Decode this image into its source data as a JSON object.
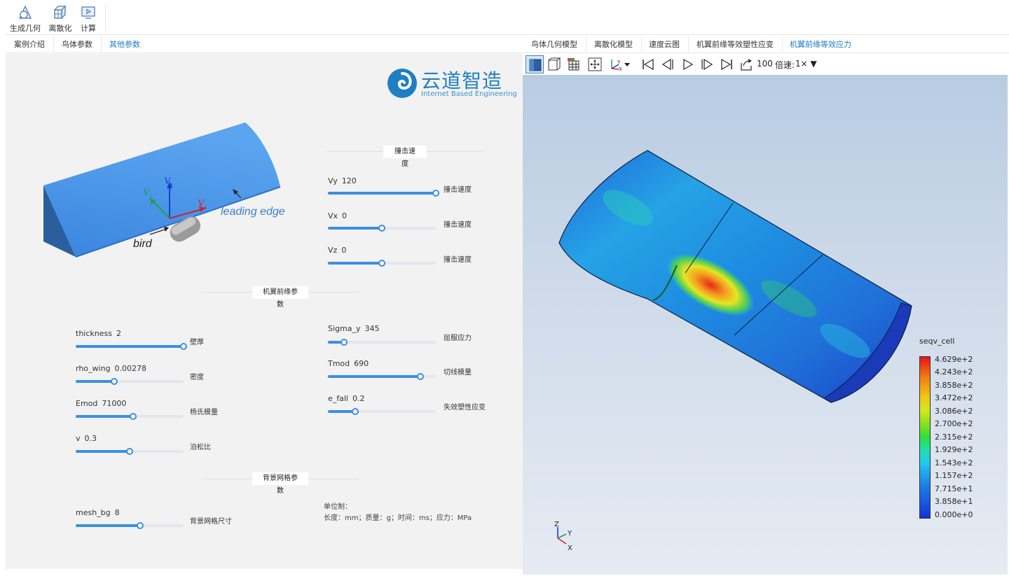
{
  "toolbar": {
    "items": [
      {
        "label": "生成几何",
        "icon": "geometry-icon"
      },
      {
        "label": "离散化",
        "icon": "mesh-cube-icon"
      },
      {
        "label": "计算",
        "icon": "compute-monitor-icon"
      }
    ]
  },
  "left_tabs": [
    {
      "label": "案例介绍",
      "active": false
    },
    {
      "label": "鸟体参数",
      "active": false
    },
    {
      "label": "其他参数",
      "active": true
    }
  ],
  "right_tabs": [
    {
      "label": "鸟体几何模型",
      "active": false
    },
    {
      "label": "离散化模型",
      "active": false
    },
    {
      "label": "速度云图",
      "active": false
    },
    {
      "label": "机翼前缘等效塑性应变",
      "active": false
    },
    {
      "label": "机翼前缘等效应力",
      "active": true
    }
  ],
  "logo": {
    "title": "云道智造",
    "subtitle": "Internet Based Engineering"
  },
  "diagram": {
    "vz": "V",
    "vz_sub": "z",
    "vy": "V",
    "vy_sub": "y",
    "vx": "V",
    "vx_sub": "x",
    "leading_edge": "leading edge",
    "bird": "bird"
  },
  "sections": {
    "impact_velocity": "撞击速度",
    "wing_params": "机翼前缘参数",
    "bg_mesh": "背景网格参数"
  },
  "params": {
    "vy": {
      "name": "Vy",
      "value": "120",
      "fraction": 1.0,
      "desc": "撞击速度"
    },
    "vx": {
      "name": "Vx",
      "value": "0",
      "fraction": 0.5,
      "desc": "撞击速度"
    },
    "vz": {
      "name": "Vz",
      "value": "0",
      "fraction": 0.5,
      "desc": "撞击速度"
    },
    "thickness": {
      "name": "thickness",
      "value": "2",
      "fraction": 1.0,
      "desc": "壁厚"
    },
    "rho_wing": {
      "name": "rho_wing",
      "value": "0.00278",
      "fraction": 0.36,
      "desc": "密度"
    },
    "emod": {
      "name": "Emod",
      "value": "71000",
      "fraction": 0.53,
      "desc": "杨氏模量"
    },
    "v": {
      "name": "v",
      "value": "0.3",
      "fraction": 0.5,
      "desc": "泊松比"
    },
    "sigma_y": {
      "name": "Sigma_y",
      "value": "345",
      "fraction": 0.15,
      "desc": "屈服应力"
    },
    "tmod": {
      "name": "Tmod",
      "value": "690",
      "fraction": 0.86,
      "desc": "切线模量"
    },
    "e_fall": {
      "name": "e_fall",
      "value": "0.2",
      "fraction": 0.25,
      "desc": "失效塑性应变"
    },
    "mesh_bg": {
      "name": "mesh_bg",
      "value": "8",
      "fraction": 0.6,
      "desc": "背景网格尺寸"
    }
  },
  "units": {
    "line1": "单位制：",
    "line2": "长度：mm；质量：g；时间：ms；应力：MPa"
  },
  "view_toolbar": {
    "frame": "100",
    "speed_label": "倍速:",
    "speed_value": "1×"
  },
  "legend": {
    "title": "seqv_cell",
    "labels": [
      "4.629e+2",
      "4.243e+2",
      "3.858e+2",
      "3.472e+2",
      "3.086e+2",
      "2.700e+2",
      "2.315e+2",
      "1.929e+2",
      "1.543e+2",
      "1.157e+2",
      "7.715e+1",
      "3.858e+1",
      "0.000e+0"
    ]
  },
  "triad": {
    "z": "Z",
    "y": "Y",
    "x": "X"
  },
  "colors": {
    "accent": "#1e7ac9",
    "slider": "#3c8fdf",
    "wing": "#3f8fe6"
  }
}
